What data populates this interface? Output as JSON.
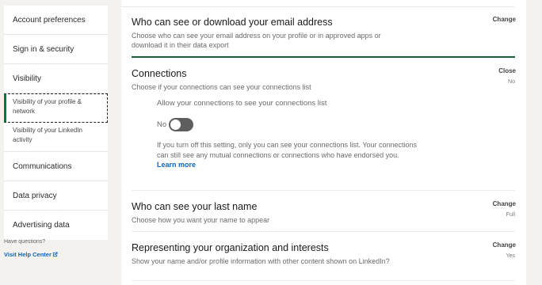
{
  "sidebar": {
    "items": [
      {
        "label": "Account preferences"
      },
      {
        "label": "Sign in & security"
      },
      {
        "label": "Visibility"
      }
    ],
    "sub_items": [
      {
        "label": "Visibility of your profile & network"
      },
      {
        "label": "Visibility of your LinkedIn activity"
      }
    ],
    "items_after": [
      {
        "label": "Communications"
      },
      {
        "label": "Data privacy"
      },
      {
        "label": "Advertising data"
      }
    ],
    "help_text": "Have questions?",
    "help_link": "Visit Help Center"
  },
  "settings": [
    {
      "title": "Who can see or download your email address",
      "desc": "Choose who can see your email address on your profile or in approved apps or download it in their data export",
      "action": "Change",
      "status": ""
    },
    {
      "title": "Connections",
      "desc": "Choose if your connections can see your connections list",
      "action": "Close",
      "status": "No"
    },
    {
      "title": "Who can see your last name",
      "desc": "Choose how you want your name to appear",
      "action": "Change",
      "status": "Full"
    },
    {
      "title": "Representing your organization and interests",
      "desc": "Show your name and/or profile information with other content shown on LinkedIn?",
      "action": "Change",
      "status": "Yes"
    }
  ],
  "connections_panel": {
    "toggle_label": "Allow your connections to see your connections list",
    "toggle_state_text": "No",
    "toggle_on": false,
    "note": "If you turn off this setting, only you can see your connections list. Your connections can still see any mutual connections or connections who have endorsed you.",
    "learn_more": "Learn more"
  },
  "colors": {
    "accent_green": "#057642",
    "link_blue": "#0a66c2"
  }
}
